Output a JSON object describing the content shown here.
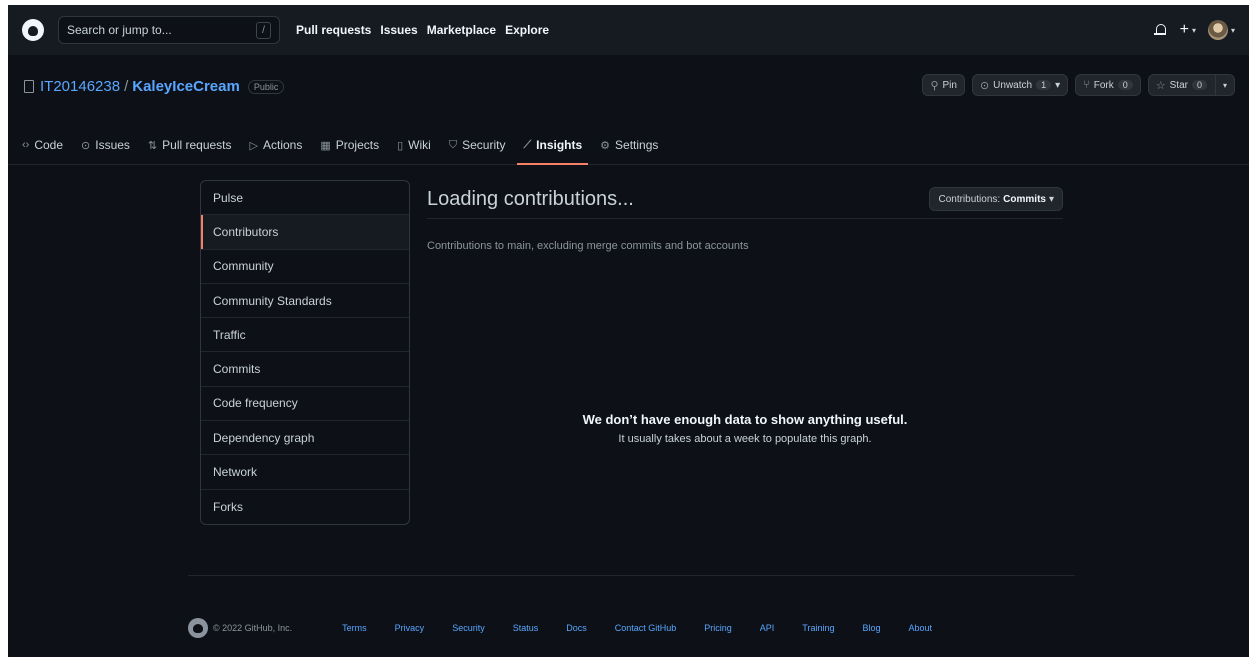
{
  "header": {
    "search_placeholder": "Search or jump to...",
    "search_shortcut": "/",
    "nav": [
      "Pull requests",
      "Issues",
      "Marketplace",
      "Explore"
    ],
    "plus_icon": "+",
    "dropdown_caret": "▾"
  },
  "repo": {
    "owner": "IT20146238",
    "separator": "/",
    "name": "KaleyIceCream",
    "visibility": "Public",
    "actions": {
      "pin": "Pin",
      "unwatch": "Unwatch",
      "unwatch_count": "1",
      "fork": "Fork",
      "fork_count": "0",
      "star": "Star",
      "star_count": "0"
    },
    "tabs": [
      {
        "label": "Code",
        "icon": "‹›"
      },
      {
        "label": "Issues",
        "icon": "⊙"
      },
      {
        "label": "Pull requests",
        "icon": "⇅"
      },
      {
        "label": "Actions",
        "icon": "▷"
      },
      {
        "label": "Projects",
        "icon": "▦"
      },
      {
        "label": "Wiki",
        "icon": "▯"
      },
      {
        "label": "Security",
        "icon": "⛉"
      },
      {
        "label": "Insights",
        "icon": "⟋"
      },
      {
        "label": "Settings",
        "icon": "⚙"
      }
    ],
    "active_tab": "Insights"
  },
  "sidebar": {
    "items": [
      "Pulse",
      "Contributors",
      "Community",
      "Community Standards",
      "Traffic",
      "Commits",
      "Code frequency",
      "Dependency graph",
      "Network",
      "Forks"
    ],
    "selected": "Contributors"
  },
  "main": {
    "title": "Loading contributions...",
    "dropdown_prefix": "Contributions:",
    "dropdown_value": "Commits",
    "subtitle": "Contributions to main, excluding merge commits and bot accounts",
    "empty_title": "We don’t have enough data to show anything useful.",
    "empty_text": "It usually takes about a week to populate this graph."
  },
  "footer": {
    "copyright": "© 2022 GitHub, Inc.",
    "links": [
      "Terms",
      "Privacy",
      "Security",
      "Status",
      "Docs",
      "Contact GitHub",
      "Pricing",
      "API",
      "Training",
      "Blog",
      "About"
    ]
  },
  "colors": {
    "background": "#0d1117",
    "header": "#161b22",
    "link": "#58a6ff",
    "accent": "#f78166"
  }
}
